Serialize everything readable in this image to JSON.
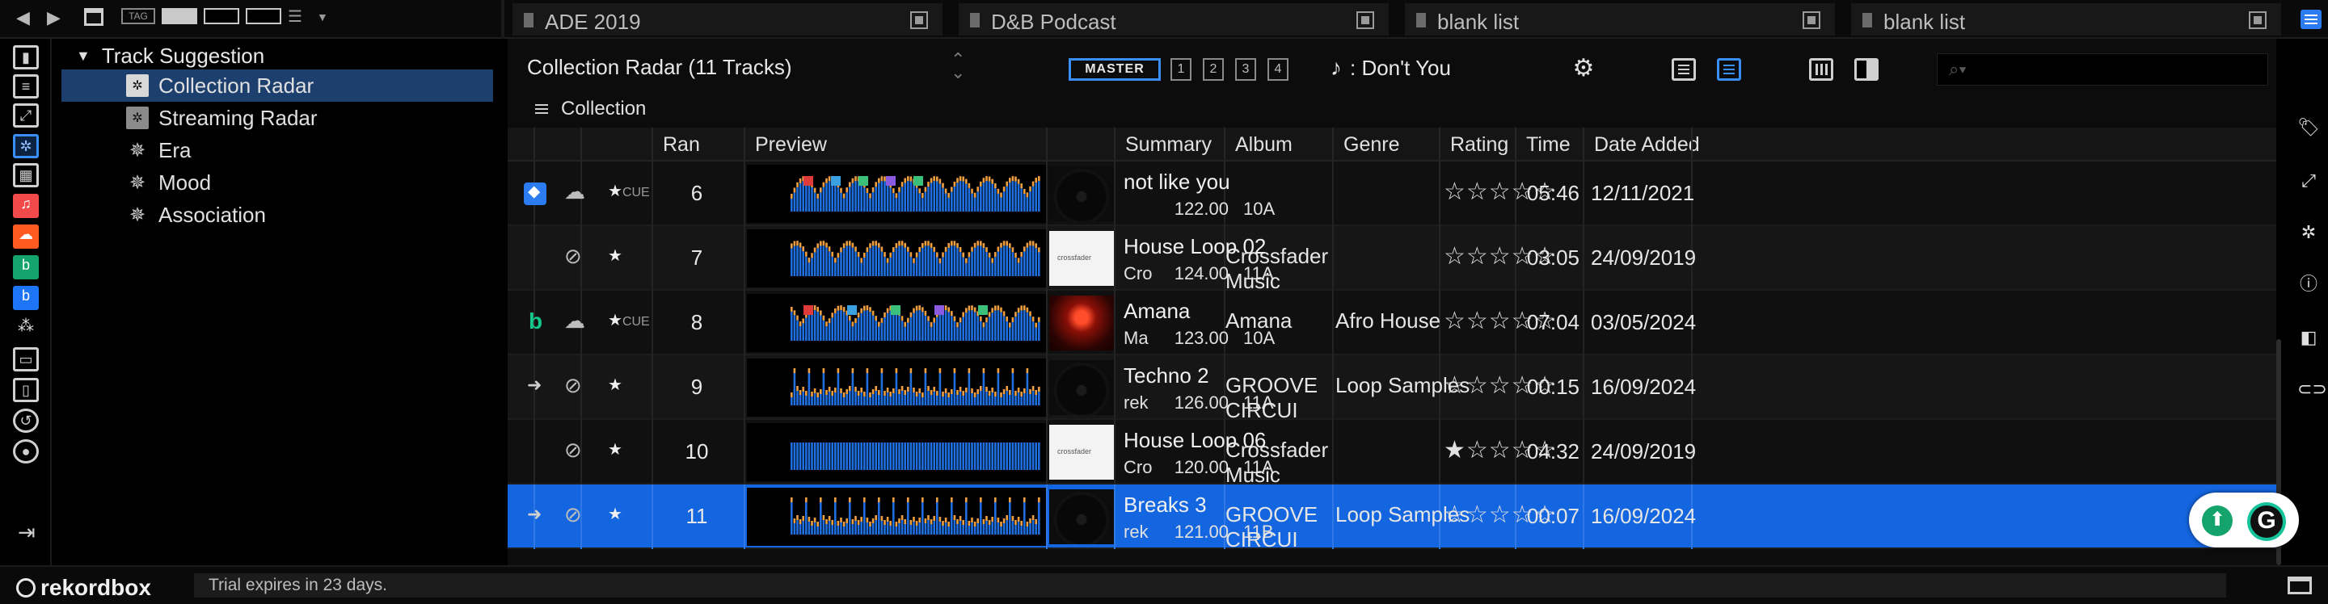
{
  "toolbar": {
    "tag_label": "TAG"
  },
  "playlist_tabs": [
    {
      "label": "ADE 2019"
    },
    {
      "label": "D&B Podcast"
    },
    {
      "label": "blank list"
    },
    {
      "label": "blank list"
    }
  ],
  "tree": {
    "root_label": "Track Suggestion",
    "items": [
      {
        "label": "Collection Radar",
        "icon": "radar-icon",
        "selected": true
      },
      {
        "label": "Streaming Radar",
        "icon": "radar-icon",
        "selected": false
      },
      {
        "label": "Era",
        "icon": "gear-star-icon",
        "selected": false
      },
      {
        "label": "Mood",
        "icon": "gear-star-icon",
        "selected": false
      },
      {
        "label": "Association",
        "icon": "gear-star-icon",
        "selected": false
      }
    ]
  },
  "header": {
    "list_title": "Collection Radar (11 Tracks)",
    "master_label": "MASTER",
    "decks": [
      "1",
      "2",
      "3",
      "4"
    ],
    "now_playing": ": Don't You",
    "search_placeholder": ""
  },
  "breadcrumb": {
    "label": "Collection"
  },
  "table": {
    "columns": {
      "rank": "Ran",
      "preview": "Preview",
      "summary": "Summary",
      "album": "Album",
      "genre": "Genre",
      "rating": "Rating",
      "time": "Time",
      "date_added": "Date Added"
    },
    "rows": [
      {
        "rank": "6",
        "title": "not like you",
        "artist": "",
        "bpm": "122.00",
        "key": "10A",
        "album": "",
        "genre": "",
        "rating": 0,
        "rating_text": "☆☆☆☆☆",
        "time": "05:46",
        "date": "12/11/2021",
        "source_icon": "dropbox-icon",
        "cue_text": "CUE",
        "art": "disc"
      },
      {
        "rank": "7",
        "title": "House Loop 02",
        "artist": "Cro",
        "bpm": "124.00",
        "key": "11A",
        "album": "Crossfader Music",
        "genre": "",
        "rating": 0,
        "rating_text": "☆☆☆☆☆",
        "time": "03:05",
        "date": "24/09/2019",
        "source_icon": "",
        "cue_text": "",
        "art": "white"
      },
      {
        "rank": "8",
        "title": "Amana",
        "artist": "Ma",
        "bpm": "123.00",
        "key": "10A",
        "album": "Amana",
        "genre": "Afro House",
        "rating": 0,
        "rating_text": "☆☆☆☆☆",
        "time": "07:04",
        "date": "03/05/2024",
        "source_icon": "beatport-icon",
        "cue_text": "CUE",
        "art": "red"
      },
      {
        "rank": "9",
        "title": "Techno 2",
        "artist": "rek",
        "bpm": "126.00",
        "key": "11A",
        "album": "GROOVE CIRCUI",
        "genre": "Loop Samples",
        "rating": 0,
        "rating_text": "☆☆☆☆☆",
        "time": "00:15",
        "date": "16/09/2024",
        "source_icon": "arrow-icon",
        "cue_text": "",
        "art": "disc"
      },
      {
        "rank": "10",
        "title": "House Loop 06",
        "artist": "Cro",
        "bpm": "120.00",
        "key": "11A",
        "album": "Crossfader Music",
        "genre": "",
        "rating": 1,
        "rating_text": "★☆☆☆☆",
        "time": "04:32",
        "date": "24/09/2019",
        "source_icon": "",
        "cue_text": "",
        "art": "white"
      },
      {
        "rank": "11",
        "title": "Breaks 3",
        "artist": "rek",
        "bpm": "121.00",
        "key": "11B",
        "album": "GROOVE CIRCUI",
        "genre": "Loop Samples",
        "rating": 0,
        "rating_text": "☆☆☆☆☆",
        "time": "00:07",
        "date": "16/09/2024",
        "source_icon": "arrow-icon",
        "cue_text": "",
        "art": "disc",
        "selected": true
      }
    ]
  },
  "status": {
    "app_name": "rekordbox",
    "trial_text": "Trial expires in 23 days."
  },
  "colors": {
    "accent": "#1466e0",
    "selected_tree": "#1d3f6e",
    "waveform_blue": "#1f6fe0",
    "waveform_orange": "#f0a040"
  }
}
